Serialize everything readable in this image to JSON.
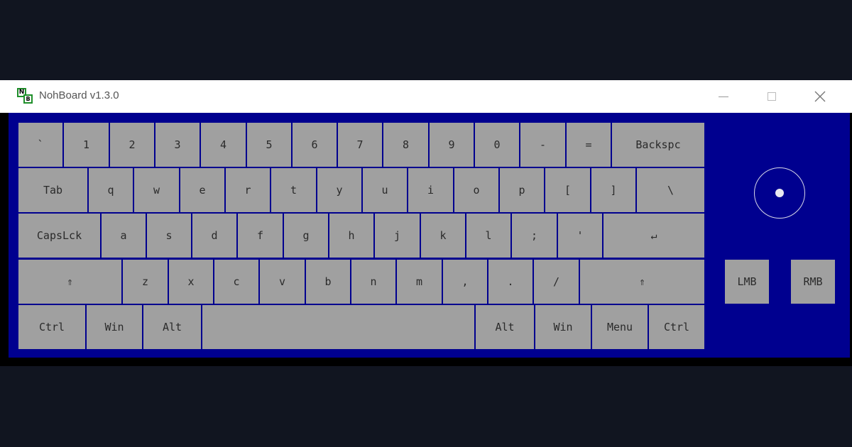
{
  "window": {
    "title": "NohBoard v1.3.0",
    "icon_letters": [
      "N",
      "B"
    ],
    "controls": [
      "minimize-icon",
      "maximize-icon",
      "close-icon"
    ]
  },
  "colors": {
    "page_background": "#111520",
    "titlebar": "#ffffff",
    "keyboard_background": "#00008f",
    "key_fill": "#a0a0a0",
    "key_text": "#2a2a2a"
  },
  "keyboard": {
    "row1": [
      "`",
      "1",
      "2",
      "3",
      "4",
      "5",
      "6",
      "7",
      "8",
      "9",
      "0",
      "-",
      "=",
      "Backspc"
    ],
    "row2": [
      "Tab",
      "q",
      "w",
      "e",
      "r",
      "t",
      "y",
      "u",
      "i",
      "o",
      "p",
      "[",
      "]",
      "\\"
    ],
    "row3": [
      "CapsLck",
      "a",
      "s",
      "d",
      "f",
      "g",
      "h",
      "j",
      "k",
      "l",
      ";",
      "'",
      "↵"
    ],
    "row4": [
      "⇑",
      "z",
      "x",
      "c",
      "v",
      "b",
      "n",
      "m",
      ",",
      ".",
      "/",
      "⇑"
    ],
    "row5": [
      "Ctrl",
      "Win",
      "Alt",
      "",
      "Alt",
      "Win",
      "Menu",
      "Ctrl"
    ]
  },
  "mouse": {
    "buttons": [
      "LMB",
      "RMB"
    ],
    "trackball_icon": "mouse-speed-indicator-icon"
  }
}
